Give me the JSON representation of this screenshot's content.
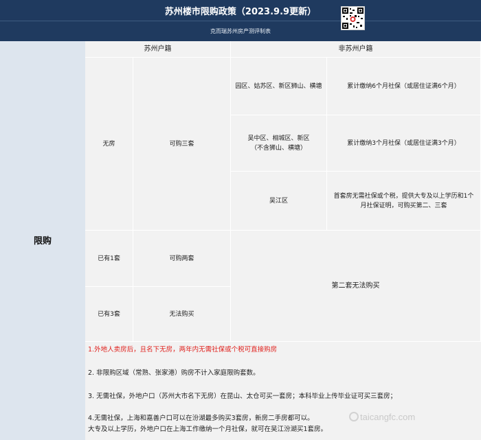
{
  "header": {
    "title": "苏州楼市限购政策（2023.9.9更新）",
    "subtitle": "克而瑞苏州房产测评制表"
  },
  "side": {
    "label": "限购"
  },
  "columns": {
    "local": "苏州户籍",
    "nonlocal": "非苏州户籍"
  },
  "local_rows": [
    {
      "status": "无房",
      "quota": "可购三套"
    },
    {
      "status": "已有1套",
      "quota": "可购两套"
    },
    {
      "status": "已有3套",
      "quota": "无法购买"
    }
  ],
  "nonlocal_rows": [
    {
      "area": "园区、姑苏区、新区狮山、横塘",
      "rule": "累计缴纳6个月社保（或居住证满6个月）"
    },
    {
      "area": "吴中区、相城区、新区\n（不含狮山、横塘）",
      "rule": "累计缴纳3个月社保（或居住证满3个月）"
    },
    {
      "area": "吴江区",
      "rule": "首套房无需社保或个税，提供大专及以上学历和1个月社保证明，可购买第二、三套"
    }
  ],
  "nonlocal_second": "第二套无法购买",
  "notes": [
    "1.外地人卖房后，且名下无房，两年内无需社保或个税可直接购房",
    "2. 非限购区域（常熟、张家港）购房不计入家庭限购套数。",
    "3. 无需社保，外地户口（苏州大市名下无房）在昆山、太仓可买一套房；本科毕业上传毕业证可买三套房；",
    "4.无需社保，上海和嘉善户口可以在汾湖最多购买3套房，新房二手房都可以。",
    "大专及以上学历，外地户口在上海工作缴纳一个月社保，就可在吴江汾湖买1套房。"
  ],
  "watermark": "taicangfc.com",
  "colors": {
    "header_bg": "#1f3a5f",
    "side_bg": "#dde5ee",
    "cell_bg": "#f2f2f2",
    "note_red": "#e0201c"
  },
  "icons": {
    "qr": "qr-code-icon"
  }
}
